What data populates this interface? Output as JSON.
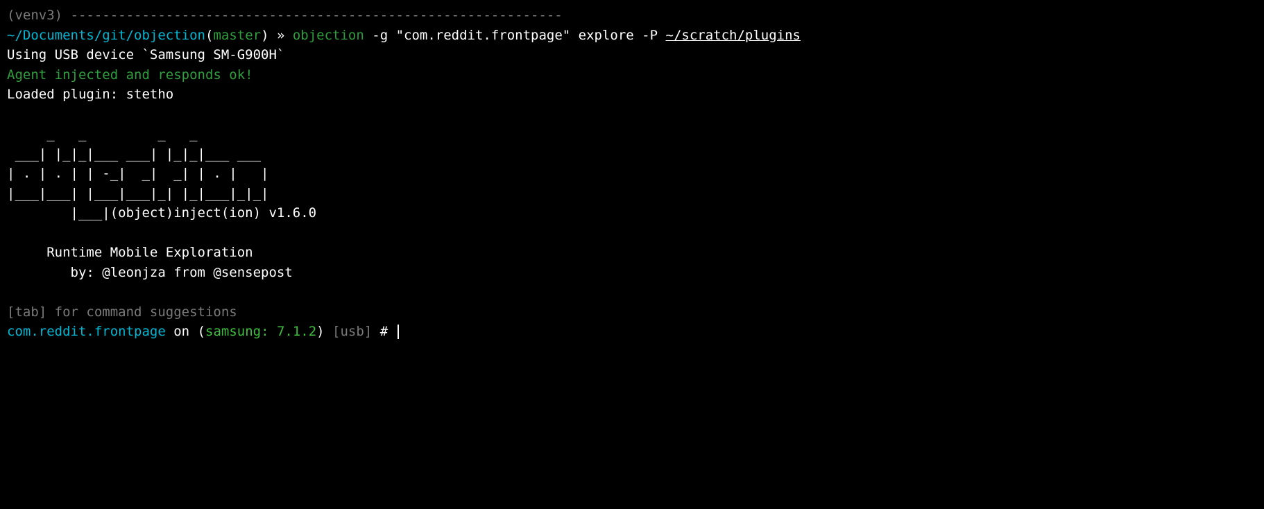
{
  "venv": "(venv3)",
  "divider": " --------------------------------------------------------------",
  "prompt": {
    "path": "~/Documents/git/objection",
    "branch_open": "(",
    "branch": "master",
    "branch_close": ")",
    "arrow": " » ",
    "cmd_name": "objection",
    "cmd_rest_pre": " -g \"com.reddit.frontpage\" explore -P ",
    "cmd_plugin_path": "~/scratch/plugins"
  },
  "out": {
    "device": "Using USB device `Samsung SM-G900H`",
    "agent": "Agent injected and responds ok!",
    "plugin": "Loaded plugin: stetho"
  },
  "ascii": "     _   _         _   _\n ___| |_|_|___ ___| |_|_|___ ___\n| . | . | | -_|  _|  _| | . |   |\n|___|___| |___|___|_| |_|___|_|_|\n        |___|(object)inject(ion) v1.6.0\n\n     Runtime Mobile Exploration\n        by: @leonjza from @sensepost",
  "hint": "[tab] for command suggestions",
  "repl": {
    "package": "com.reddit.frontpage",
    "on": " on ",
    "device_open": "(",
    "device": "samsung: 7.1.2",
    "device_close": ")",
    "conn": " [usb] ",
    "hash": "# "
  }
}
